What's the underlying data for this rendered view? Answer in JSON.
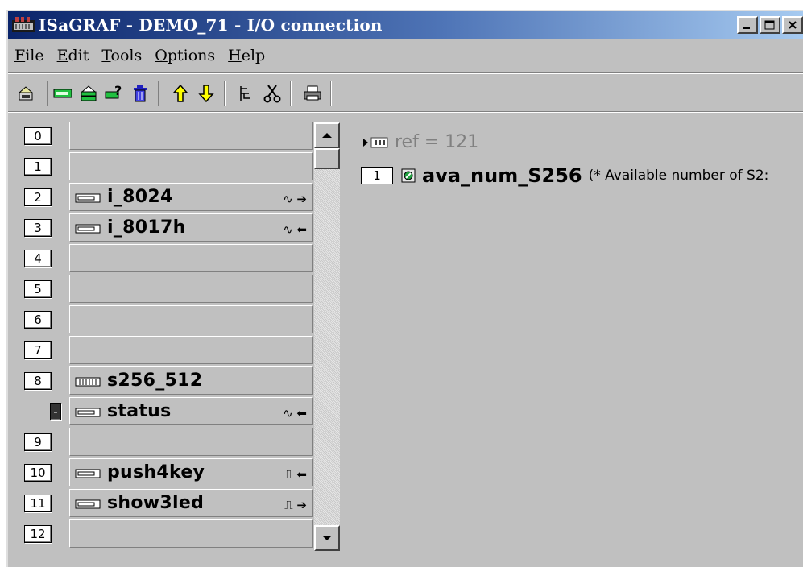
{
  "window": {
    "title": "ISaGRAF - DEMO_71 - I/O connection",
    "controls": [
      "minimize",
      "maximize",
      "close"
    ]
  },
  "menu": [
    {
      "label": "File",
      "mnemonic": "F",
      "rest": "ile"
    },
    {
      "label": "Edit",
      "mnemonic": "E",
      "rest": "dit"
    },
    {
      "label": "Tools",
      "mnemonic": "T",
      "rest": "ools"
    },
    {
      "label": "Options",
      "mnemonic": "O",
      "rest": "ptions"
    },
    {
      "label": "Help",
      "mnemonic": "H",
      "rest": "elp"
    }
  ],
  "toolbar": {
    "icons": [
      "open-board-icon",
      "board-icon",
      "board-params-icon",
      "board-help-icon",
      "delete-icon",
      "move-up-icon",
      "move-down-icon",
      "set-virtual-icon",
      "cut-icon",
      "print-icon"
    ]
  },
  "slots": [
    {
      "index": "0",
      "label": "",
      "icon": "",
      "signal": ""
    },
    {
      "index": "1",
      "label": "",
      "icon": "",
      "signal": ""
    },
    {
      "index": "2",
      "label": "i_8024",
      "icon": "board-icon",
      "signal": "∿ ➔"
    },
    {
      "index": "3",
      "label": "i_8017h",
      "icon": "board-icon",
      "signal": "∿ ⬅"
    },
    {
      "index": "4",
      "label": "",
      "icon": "",
      "signal": ""
    },
    {
      "index": "5",
      "label": "",
      "icon": "",
      "signal": ""
    },
    {
      "index": "6",
      "label": "",
      "icon": "",
      "signal": ""
    },
    {
      "index": "7",
      "label": "",
      "icon": "",
      "signal": ""
    },
    {
      "index": "8",
      "label": "s256_512",
      "icon": "equipment-icon",
      "signal": ""
    },
    {
      "index": "-",
      "label": "status",
      "icon": "board-icon",
      "signal": "∿ ⬅"
    },
    {
      "index": "9",
      "label": "",
      "icon": "",
      "signal": ""
    },
    {
      "index": "10",
      "label": "push4key",
      "icon": "board-icon",
      "signal": "⎍ ⬅"
    },
    {
      "index": "11",
      "label": "show3led",
      "icon": "board-icon",
      "signal": "⎍ ➔"
    },
    {
      "index": "12",
      "label": "",
      "icon": "",
      "signal": ""
    }
  ],
  "detail": {
    "ref": "ref = 121",
    "var_index": "1",
    "var_name": "ava_num_S256",
    "var_comment": "(* Available number of S2:"
  }
}
